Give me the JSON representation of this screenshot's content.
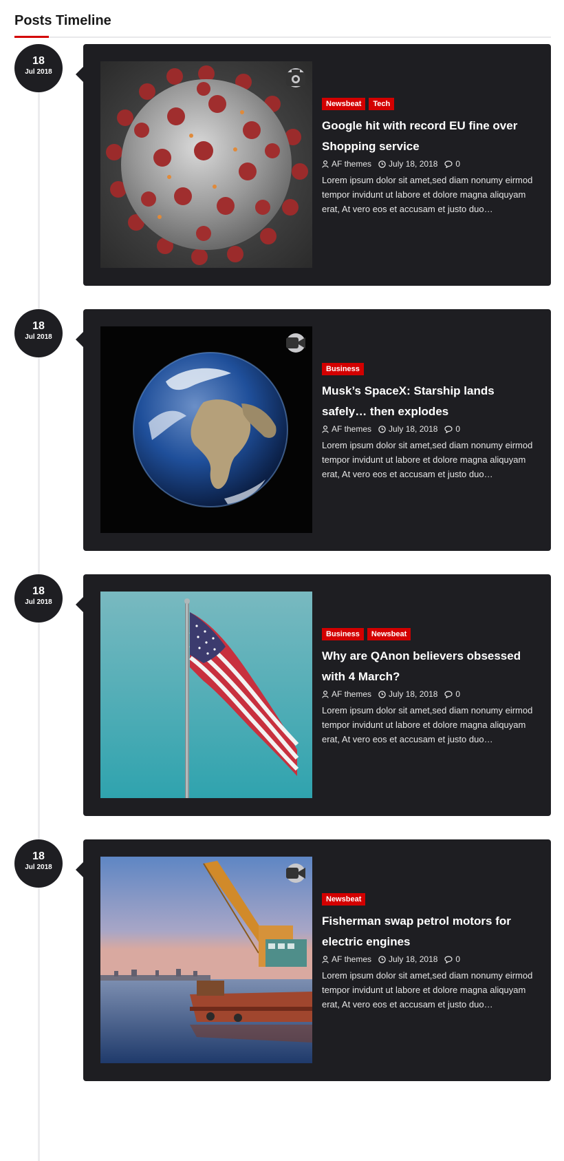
{
  "header": {
    "title": "Posts Timeline"
  },
  "posts": [
    {
      "date": {
        "day": "18",
        "month": "Jul 2018"
      },
      "media_icon": "camera-icon",
      "image": "coronavirus-illustration",
      "tags": [
        "Newsbeat",
        "Tech"
      ],
      "title": "Google hit with record EU fine over Shopping service",
      "author": "AF themes",
      "date_text": "July 18, 2018",
      "comments": "0",
      "excerpt": "Lorem ipsum dolor sit amet,sed diam nonumy eirmod tempor invidunt ut labore et dolore magna aliquyam erat, At vero eos et accusam et justo duo…"
    },
    {
      "date": {
        "day": "18",
        "month": "Jul 2018"
      },
      "media_icon": "video-icon",
      "image": "earth-from-space",
      "tags": [
        "Business"
      ],
      "title": "Musk’s SpaceX: Starship lands safely… then explodes",
      "author": "AF themes",
      "date_text": "July 18, 2018",
      "comments": "0",
      "excerpt": "Lorem ipsum dolor sit amet,sed diam nonumy eirmod tempor invidunt ut labore et dolore magna aliquyam erat, At vero eos et accusam et justo duo…"
    },
    {
      "date": {
        "day": "18",
        "month": "Jul 2018"
      },
      "media_icon": "",
      "image": "american-flag",
      "tags": [
        "Business",
        "Newsbeat"
      ],
      "title": "Why are QAnon believers obsessed with 4 March?",
      "author": "AF themes",
      "date_text": "July 18, 2018",
      "comments": "0",
      "excerpt": "Lorem ipsum dolor sit amet,sed diam nonumy eirmod tempor invidunt ut labore et dolore magna aliquyam erat, At vero eos et accusam et justo duo…"
    },
    {
      "date": {
        "day": "18",
        "month": "Jul 2018"
      },
      "media_icon": "video-icon",
      "image": "crane-barge-harbor",
      "tags": [
        "Newsbeat"
      ],
      "title": "Fisherman swap petrol motors for electric engines",
      "author": "AF themes",
      "date_text": "July 18, 2018",
      "comments": "0",
      "excerpt": "Lorem ipsum dolor sit amet,sed diam nonumy eirmod tempor invidunt ut labore et dolore magna aliquyam erat, At vero eos et accusam et justo duo…"
    }
  ],
  "colors": {
    "accent": "#d30000",
    "card_background": "#1e1e22",
    "card_text": "#ffffff",
    "page_background": "#ffffff",
    "timeline_line": "#ececee"
  }
}
